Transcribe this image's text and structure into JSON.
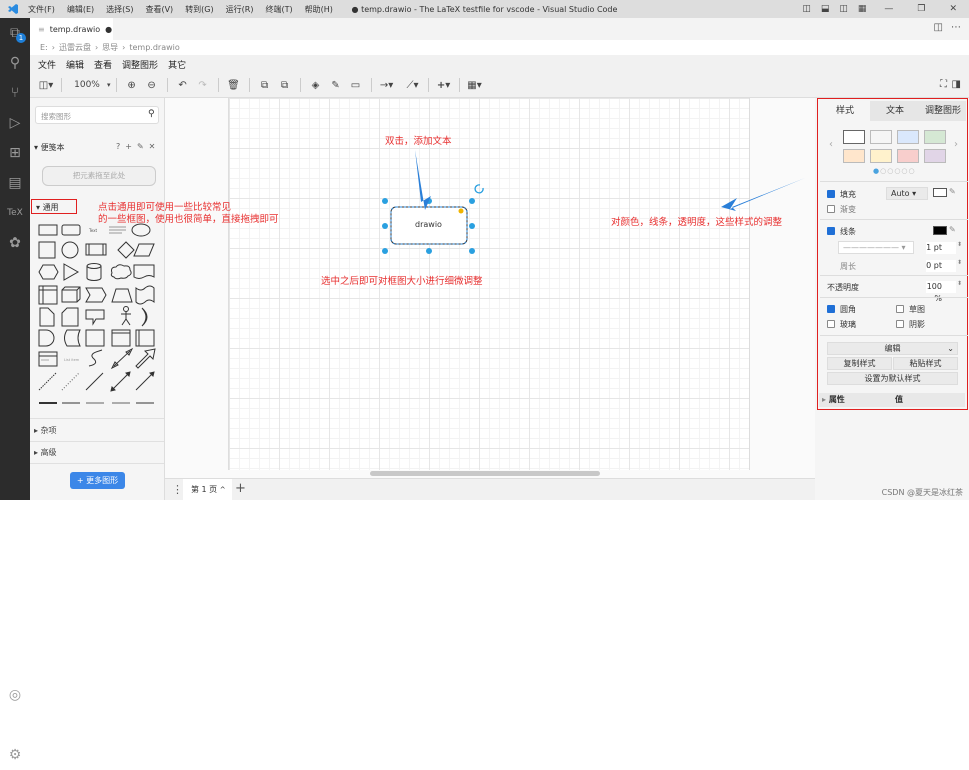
{
  "window": {
    "title": "● temp.drawio - The LaTeX testfile for vscode - Visual Studio Code",
    "menu": [
      "文件(F)",
      "编辑(E)",
      "选择(S)",
      "查看(V)",
      "转到(G)",
      "运行(R)",
      "终端(T)",
      "帮助(H)"
    ]
  },
  "activity_bar": {
    "explorer_badge": "1",
    "tex_label": "TeX"
  },
  "tab": {
    "label": "temp.drawio",
    "dirty": "●"
  },
  "breadcrumb": [
    "E:",
    "迅雷云盘",
    "思导",
    "temp.drawio"
  ],
  "drawio_menu": [
    "文件",
    "编辑",
    "查看",
    "调整图形",
    "其它"
  ],
  "toolbar": {
    "zoom": "100%"
  },
  "left_panel": {
    "search_placeholder": "搜索图形",
    "scratchpad": {
      "title": "便笺本",
      "actions": [
        "?",
        "+",
        "✎",
        "✕"
      ],
      "dropzone": "把元素拖至此处"
    },
    "general": {
      "title": "通用"
    },
    "misc": {
      "title": "杂项"
    },
    "advanced": {
      "title": "高级"
    },
    "more_shapes": "+ 更多图形"
  },
  "canvas": {
    "shape_label": "drawio",
    "annotations": {
      "double_click": "双击，添加文本",
      "resize": "选中之后即可对框图大小进行细微调整",
      "general_line1": "点击通用即可使用一些比较常见",
      "general_line2": "的一些框图，使用也很简单，直接拖拽即可",
      "style": "对颜色，线条，透明度，这些样式的调整"
    },
    "accent": "#2a8be0",
    "annotation_color": "#e83030"
  },
  "page_bar": {
    "page": "第 1 页",
    "chevron": "^",
    "add": "+"
  },
  "format_panel": {
    "tabs": [
      "样式",
      "文本",
      "调整图形"
    ],
    "swatches": [
      "#ffffff",
      "#f5f5f5",
      "#dae8fc",
      "#d5e8d4",
      "#ffe6cc",
      "#fff2cc",
      "#f8cecc",
      "#e1d5e7"
    ],
    "fill": {
      "label": "填充",
      "checked": true,
      "mode": "Auto",
      "color": "#ffffff"
    },
    "gradient": {
      "label": "渐变",
      "checked": false
    },
    "line": {
      "label": "线条",
      "checked": true,
      "color": "#000000",
      "width": "1 pt"
    },
    "perimeter": {
      "label": "周长",
      "value": "0 pt"
    },
    "opacity": {
      "label": "不透明度",
      "value": "100 %"
    },
    "rounded": {
      "label": "圆角",
      "checked": true
    },
    "sketch": {
      "label": "草图",
      "checked": false
    },
    "glass": {
      "label": "玻璃",
      "checked": false
    },
    "shadow": {
      "label": "阴影",
      "checked": false
    },
    "edit": "编辑",
    "copy_style": "复制样式",
    "paste_style": "粘贴样式",
    "set_default": "设置为默认样式",
    "properties": {
      "property": "属性",
      "value": "值"
    }
  },
  "watermark": "CSDN @夏天是冰红茶"
}
